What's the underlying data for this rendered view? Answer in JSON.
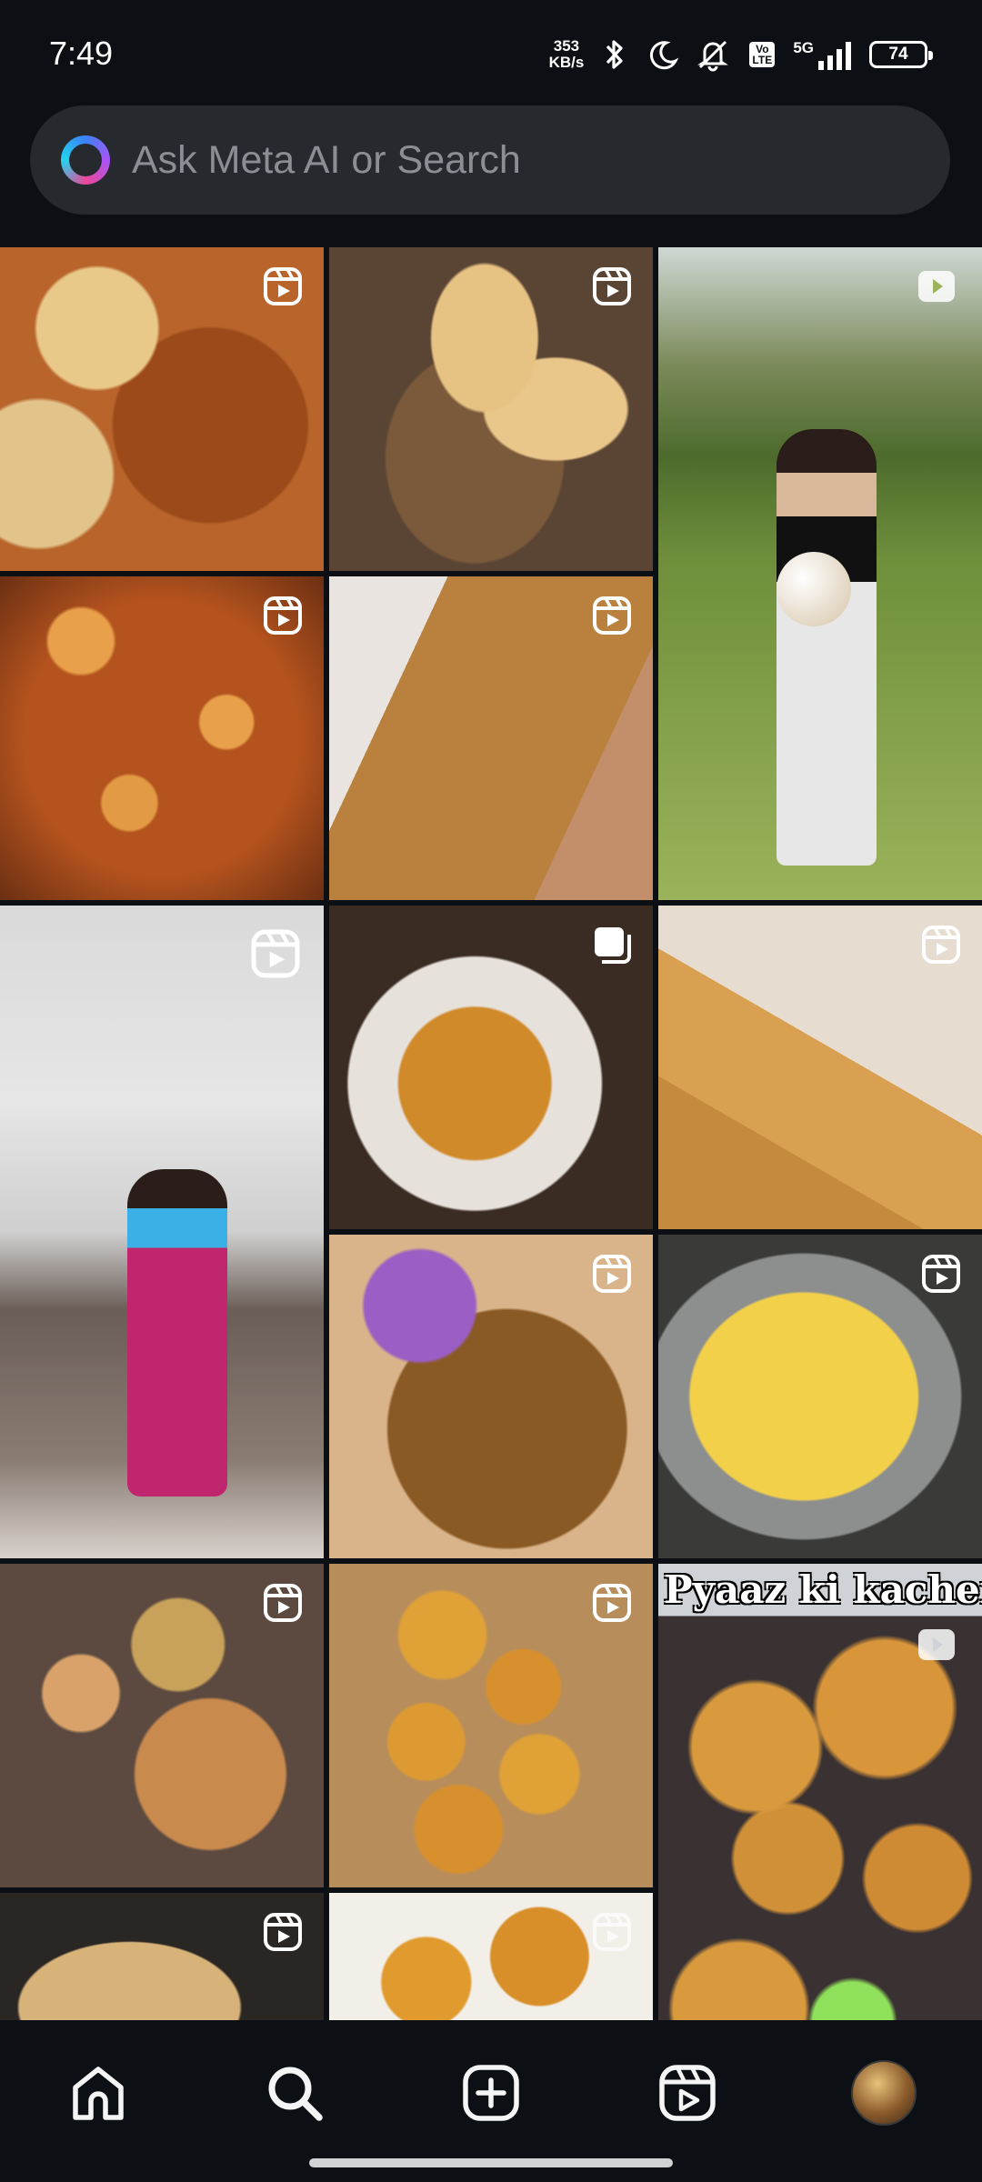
{
  "status_bar": {
    "time": "7:49",
    "net_speed_value": "353",
    "net_speed_unit": "KB/s",
    "volte_top": "Vo",
    "volte_bottom": "LTE",
    "network": "5G",
    "battery": "74",
    "icons": [
      "bluetooth-icon",
      "moon-icon",
      "mute-icon",
      "volte-icon",
      "signal-icon",
      "battery-icon"
    ]
  },
  "search": {
    "placeholder": "Ask Meta AI or Search",
    "value": ""
  },
  "grid": {
    "tiles": [
      {
        "badge": "reels-icon",
        "caption": ""
      },
      {
        "badge": "reels-icon",
        "caption": ""
      },
      {
        "badge": "play-icon",
        "caption": ""
      },
      {
        "badge": "reels-icon",
        "caption": ""
      },
      {
        "badge": "reels-icon",
        "caption": ""
      },
      {
        "badge": "reels-icon",
        "caption": ""
      },
      {
        "badge": "carousel-icon",
        "caption": ""
      },
      {
        "badge": "reels-icon",
        "caption": ""
      },
      {
        "badge": "reels-icon",
        "caption": ""
      },
      {
        "badge": "reels-icon",
        "caption": ""
      },
      {
        "badge": "reels-icon",
        "caption": ""
      },
      {
        "badge": "play-icon",
        "caption": "Pyaaz ki kacheri"
      },
      {
        "badge": "reels-icon",
        "caption": ""
      },
      {
        "badge": "reels-icon",
        "caption": ""
      }
    ]
  },
  "bottom_nav": {
    "items": [
      "home-icon",
      "search-icon",
      "create-icon",
      "reels-icon",
      "profile-avatar"
    ]
  },
  "colors": {
    "background": "#0c1014",
    "search_bg": "#262a2f",
    "placeholder": "#8b8f94",
    "icon": "#f5f5f5"
  }
}
